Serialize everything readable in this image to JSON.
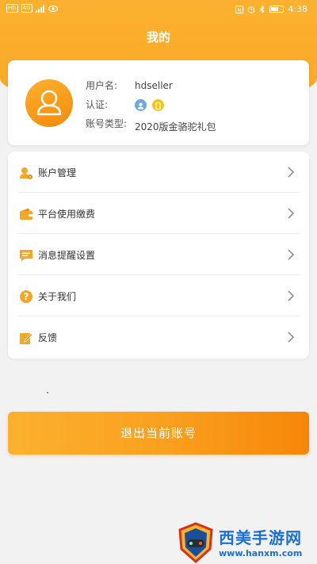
{
  "status_bar": {
    "left_chips": [
      "HD",
      "4G"
    ],
    "time": "4:38"
  },
  "page": {
    "title": "我的"
  },
  "profile": {
    "username_label": "用户名:",
    "username_value": "hdseller",
    "auth_label": "认证:",
    "account_type_label": "账号类型:",
    "account_type_value": "2020版金骆驼礼包"
  },
  "menu": {
    "items": [
      {
        "label": "账户管理",
        "icon": "user-settings-icon"
      },
      {
        "label": "平台使用缴费",
        "icon": "wallet-icon"
      },
      {
        "label": "消息提醒设置",
        "icon": "message-icon"
      },
      {
        "label": "关于我们",
        "icon": "question-icon"
      },
      {
        "label": "反馈",
        "icon": "edit-icon"
      }
    ]
  },
  "logout": {
    "label": "退出当前账号"
  },
  "watermark": {
    "title": "西美手游网",
    "url": "www.hanxm.com"
  },
  "colors": {
    "accent": "#f9a825",
    "accent_dark": "#f78608",
    "watermark_blue": "#1a6fd6"
  }
}
